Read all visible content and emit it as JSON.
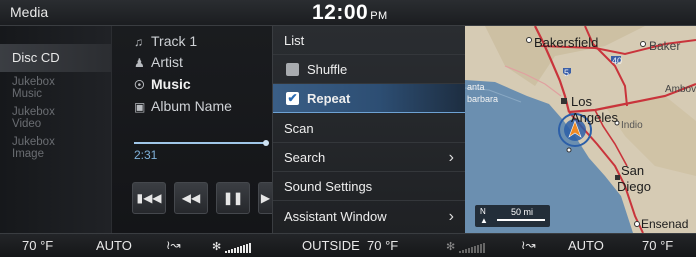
{
  "status_bar": {
    "app_title": "Media",
    "time": "12:00",
    "ampm": "PM"
  },
  "media_list": {
    "items": [
      {
        "label": "Disc CD",
        "active": true
      },
      {
        "label": "Jukebox Music",
        "active": false
      },
      {
        "label": "Jukebox Video",
        "active": false
      },
      {
        "label": "Jukebox Image",
        "active": false
      }
    ]
  },
  "now_playing": {
    "track": "Track 1",
    "artist": "Artist",
    "genre": "Music",
    "album": "Album Name",
    "elapsed": "2:31",
    "progress": 0.98,
    "icons": {
      "track": "music-note-icon",
      "artist": "person-icon",
      "genre": "genre-icon",
      "album": "album-icon"
    },
    "controls": [
      "previous-track-icon",
      "rewind-icon",
      "pause-icon",
      "fast-forward-icon"
    ]
  },
  "menu": {
    "items": [
      {
        "label": "List",
        "type": "plain"
      },
      {
        "label": "Shuffle",
        "type": "checkbox",
        "checked": false
      },
      {
        "label": "Repeat",
        "type": "checkbox",
        "checked": true
      },
      {
        "label": "Scan",
        "type": "plain"
      },
      {
        "label": "Search",
        "type": "submenu"
      },
      {
        "label": "Sound Settings",
        "type": "plain"
      },
      {
        "label": "Assistant Window",
        "type": "submenu"
      }
    ],
    "accent": "#3a6fa6"
  },
  "map": {
    "labels": {
      "bakersfield": "Bakersfield",
      "baker": "Baker",
      "ambov": "Ambov",
      "los": "Los",
      "angeles": "Angeles",
      "indio": "Indio",
      "san": "San",
      "diego": "Diego",
      "ensenada": "Ensenad",
      "santa_barbara": "barbara",
      "anta": "anta"
    },
    "highways": [
      "5",
      "40"
    ],
    "scale": {
      "north": "N",
      "distance": "50 mi"
    },
    "colors": {
      "land": "#d6cbb4",
      "ocean": "#6b8fb0",
      "road": "#c9343b"
    }
  },
  "climate": {
    "left_temp": "70 °F",
    "left_mode": "AUTO",
    "outside_label": "OUTSIDE",
    "outside_temp": "70 °F",
    "right_mode": "AUTO",
    "right_temp": "70 °F",
    "icons": {
      "airflow": "airflow-icon",
      "fan": "fan-icon"
    }
  }
}
